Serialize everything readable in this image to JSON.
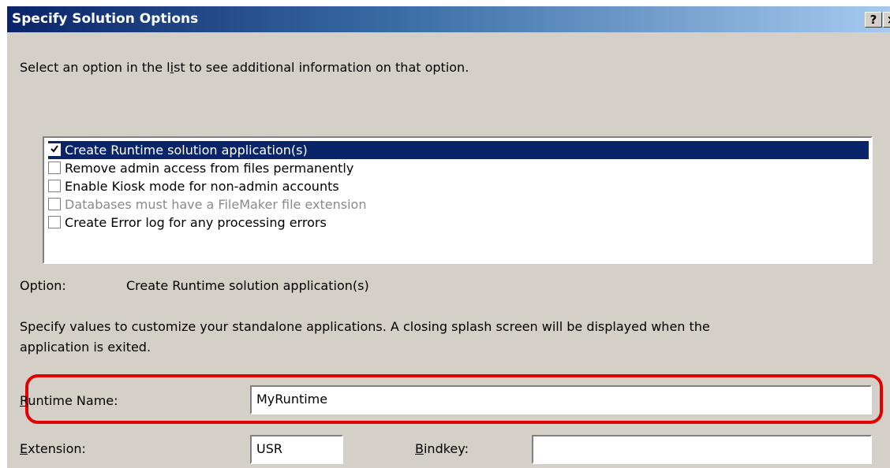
{
  "window": {
    "title": "Specify Solution Options",
    "help_label": "?",
    "close_label": "×"
  },
  "instructions": "Select an option in the list to see additional information on that option.",
  "options": [
    {
      "label": "Create Runtime solution application(s)",
      "checked": true,
      "selected": true,
      "enabled": true
    },
    {
      "label": "Remove admin access from files permanently",
      "checked": false,
      "selected": false,
      "enabled": true
    },
    {
      "label": "Enable Kiosk mode for non-admin accounts",
      "checked": false,
      "selected": false,
      "enabled": true
    },
    {
      "label": "Databases must have a FileMaker file extension",
      "checked": false,
      "selected": false,
      "enabled": false
    },
    {
      "label": "Create Error log for any processing errors",
      "checked": false,
      "selected": false,
      "enabled": true
    }
  ],
  "option_detail": {
    "label": "Option:",
    "value": "Create Runtime solution application(s)"
  },
  "description_line1": "Specify values to customize your standalone applications. A closing splash screen will be displayed when the",
  "description_line2": "application is exited.",
  "runtime_name": {
    "label": "Runtime Name:",
    "value": "MyRuntime"
  },
  "extension": {
    "label": "Extension:",
    "value": "USR"
  },
  "bindkey": {
    "label": "Bindkey:",
    "value": ""
  },
  "colors": {
    "titlebar_start": "#0a246a",
    "titlebar_end": "#a6caf0",
    "dialog_face": "#d4d0c8",
    "selection": "#0a246a",
    "highlight_ring": "#e00000"
  }
}
